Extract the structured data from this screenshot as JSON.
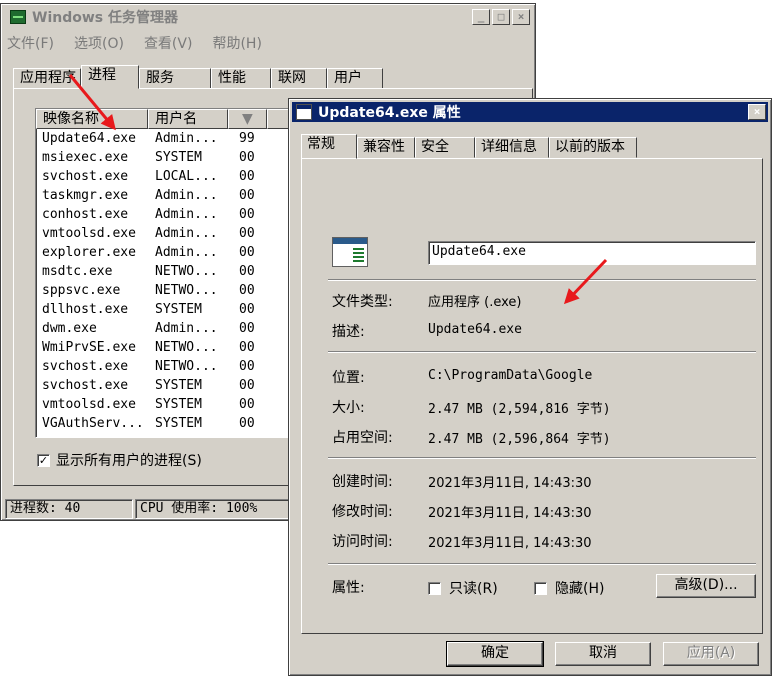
{
  "task_manager": {
    "title": "Windows 任务管理器",
    "menu": [
      "文件(F)",
      "选项(O)",
      "查看(V)",
      "帮助(H)"
    ],
    "tabs": [
      "应用程序",
      "进程",
      "服务",
      "性能",
      "联网",
      "用户"
    ],
    "active_tab": "进程",
    "columns": [
      "映像名称",
      "用户名",
      ""
    ],
    "processes": [
      {
        "name": "Update64.exe",
        "user": "Admin...",
        "cpu": "99"
      },
      {
        "name": "msiexec.exe",
        "user": "SYSTEM",
        "cpu": "00"
      },
      {
        "name": "svchost.exe",
        "user": "LOCAL...",
        "cpu": "00"
      },
      {
        "name": "taskmgr.exe",
        "user": "Admin...",
        "cpu": "00"
      },
      {
        "name": "conhost.exe",
        "user": "Admin...",
        "cpu": "00"
      },
      {
        "name": "vmtoolsd.exe",
        "user": "Admin...",
        "cpu": "00"
      },
      {
        "name": "explorer.exe",
        "user": "Admin...",
        "cpu": "00"
      },
      {
        "name": "msdtc.exe",
        "user": "NETWO...",
        "cpu": "00"
      },
      {
        "name": "sppsvc.exe",
        "user": "NETWO...",
        "cpu": "00"
      },
      {
        "name": "dllhost.exe",
        "user": "SYSTEM",
        "cpu": "00"
      },
      {
        "name": "dwm.exe",
        "user": "Admin...",
        "cpu": "00"
      },
      {
        "name": "WmiPrvSE.exe",
        "user": "NETWO...",
        "cpu": "00"
      },
      {
        "name": "svchost.exe",
        "user": "NETWO...",
        "cpu": "00"
      },
      {
        "name": "svchost.exe",
        "user": "SYSTEM",
        "cpu": "00"
      },
      {
        "name": "vmtoolsd.exe",
        "user": "SYSTEM",
        "cpu": "00"
      },
      {
        "name": "VGAuthServ...",
        "user": "SYSTEM",
        "cpu": "00"
      }
    ],
    "show_all_users_label": "显示所有用户的进程(S)",
    "show_all_users_checked": true,
    "status_processes": "进程数: 40",
    "status_cpu": "CPU 使用率: 100%"
  },
  "properties": {
    "title": "Update64.exe 属性",
    "tabs": [
      "常规",
      "兼容性",
      "安全",
      "详细信息",
      "以前的版本"
    ],
    "active_tab": "常规",
    "file_name": "Update64.exe",
    "rows": {
      "type_label": "文件类型:",
      "type_value": "应用程序 (.exe)",
      "desc_label": "描述:",
      "desc_value": "Update64.exe",
      "location_label": "位置:",
      "location_value": "C:\\ProgramData\\Google",
      "size_label": "大小:",
      "size_value": "2.47 MB (2,594,816 字节)",
      "disk_size_label": "占用空间:",
      "disk_size_value": "2.47 MB (2,596,864 字节)",
      "created_label": "创建时间:",
      "created_value": "2021年3月11日, 14:43:30",
      "modified_label": "修改时间:",
      "modified_value": "2021年3月11日, 14:43:30",
      "accessed_label": "访问时间:",
      "accessed_value": "2021年3月11日, 14:43:30"
    },
    "attributes_label": "属性:",
    "readonly_label": "只读(R)",
    "hidden_label": "隐藏(H)",
    "advanced_label": "高级(D)...",
    "ok_label": "确定",
    "cancel_label": "取消",
    "apply_label": "应用(A)"
  },
  "colors": {
    "active_titlebar": "#0a246a",
    "dialog_bg": "#d4d0c8",
    "annotation_arrow": "#e8191c"
  }
}
